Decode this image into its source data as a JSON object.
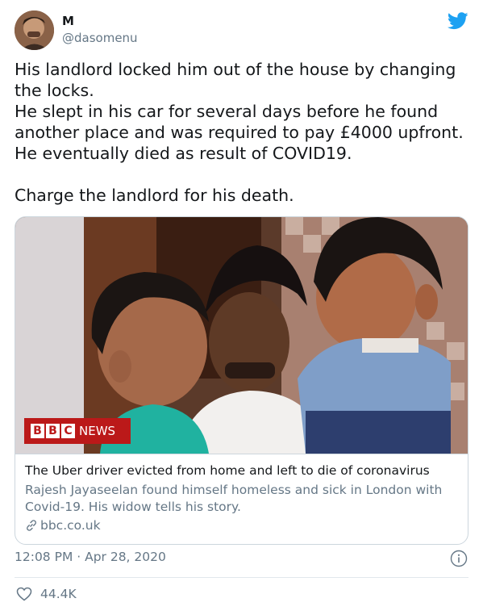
{
  "author": {
    "name": "M",
    "handle": "@dasomenu"
  },
  "tweet": {
    "lines": [
      "His landlord locked him out of the house by changing",
      "the locks.",
      "He slept in his car for several days before he found",
      "another place and was required to pay £4000 upfront.",
      "He eventually died as result of COVID19."
    ],
    "closing": "Charge the landlord for his death."
  },
  "card": {
    "logo_letters": [
      "B",
      "B",
      "C"
    ],
    "logo_word": "NEWS",
    "title": "The Uber driver evicted from home and left to die of coronavirus",
    "description": "Rajesh Jayaseelan found himself homeless and sick in London with Covid-19. His widow tells his story.",
    "domain": "bbc.co.uk"
  },
  "meta": {
    "timestamp": "12:08 PM · Apr 28, 2020"
  },
  "engagement": {
    "likes": "44.4K"
  },
  "icons": {
    "brand": "twitter-bird-icon",
    "info": "info-icon",
    "link": "link-icon",
    "like": "heart-icon"
  },
  "colors": {
    "twitter_blue": "#1da1f2",
    "bbc_red": "#bb1919",
    "secondary_text": "#657786",
    "border": "#ccd6dd"
  }
}
